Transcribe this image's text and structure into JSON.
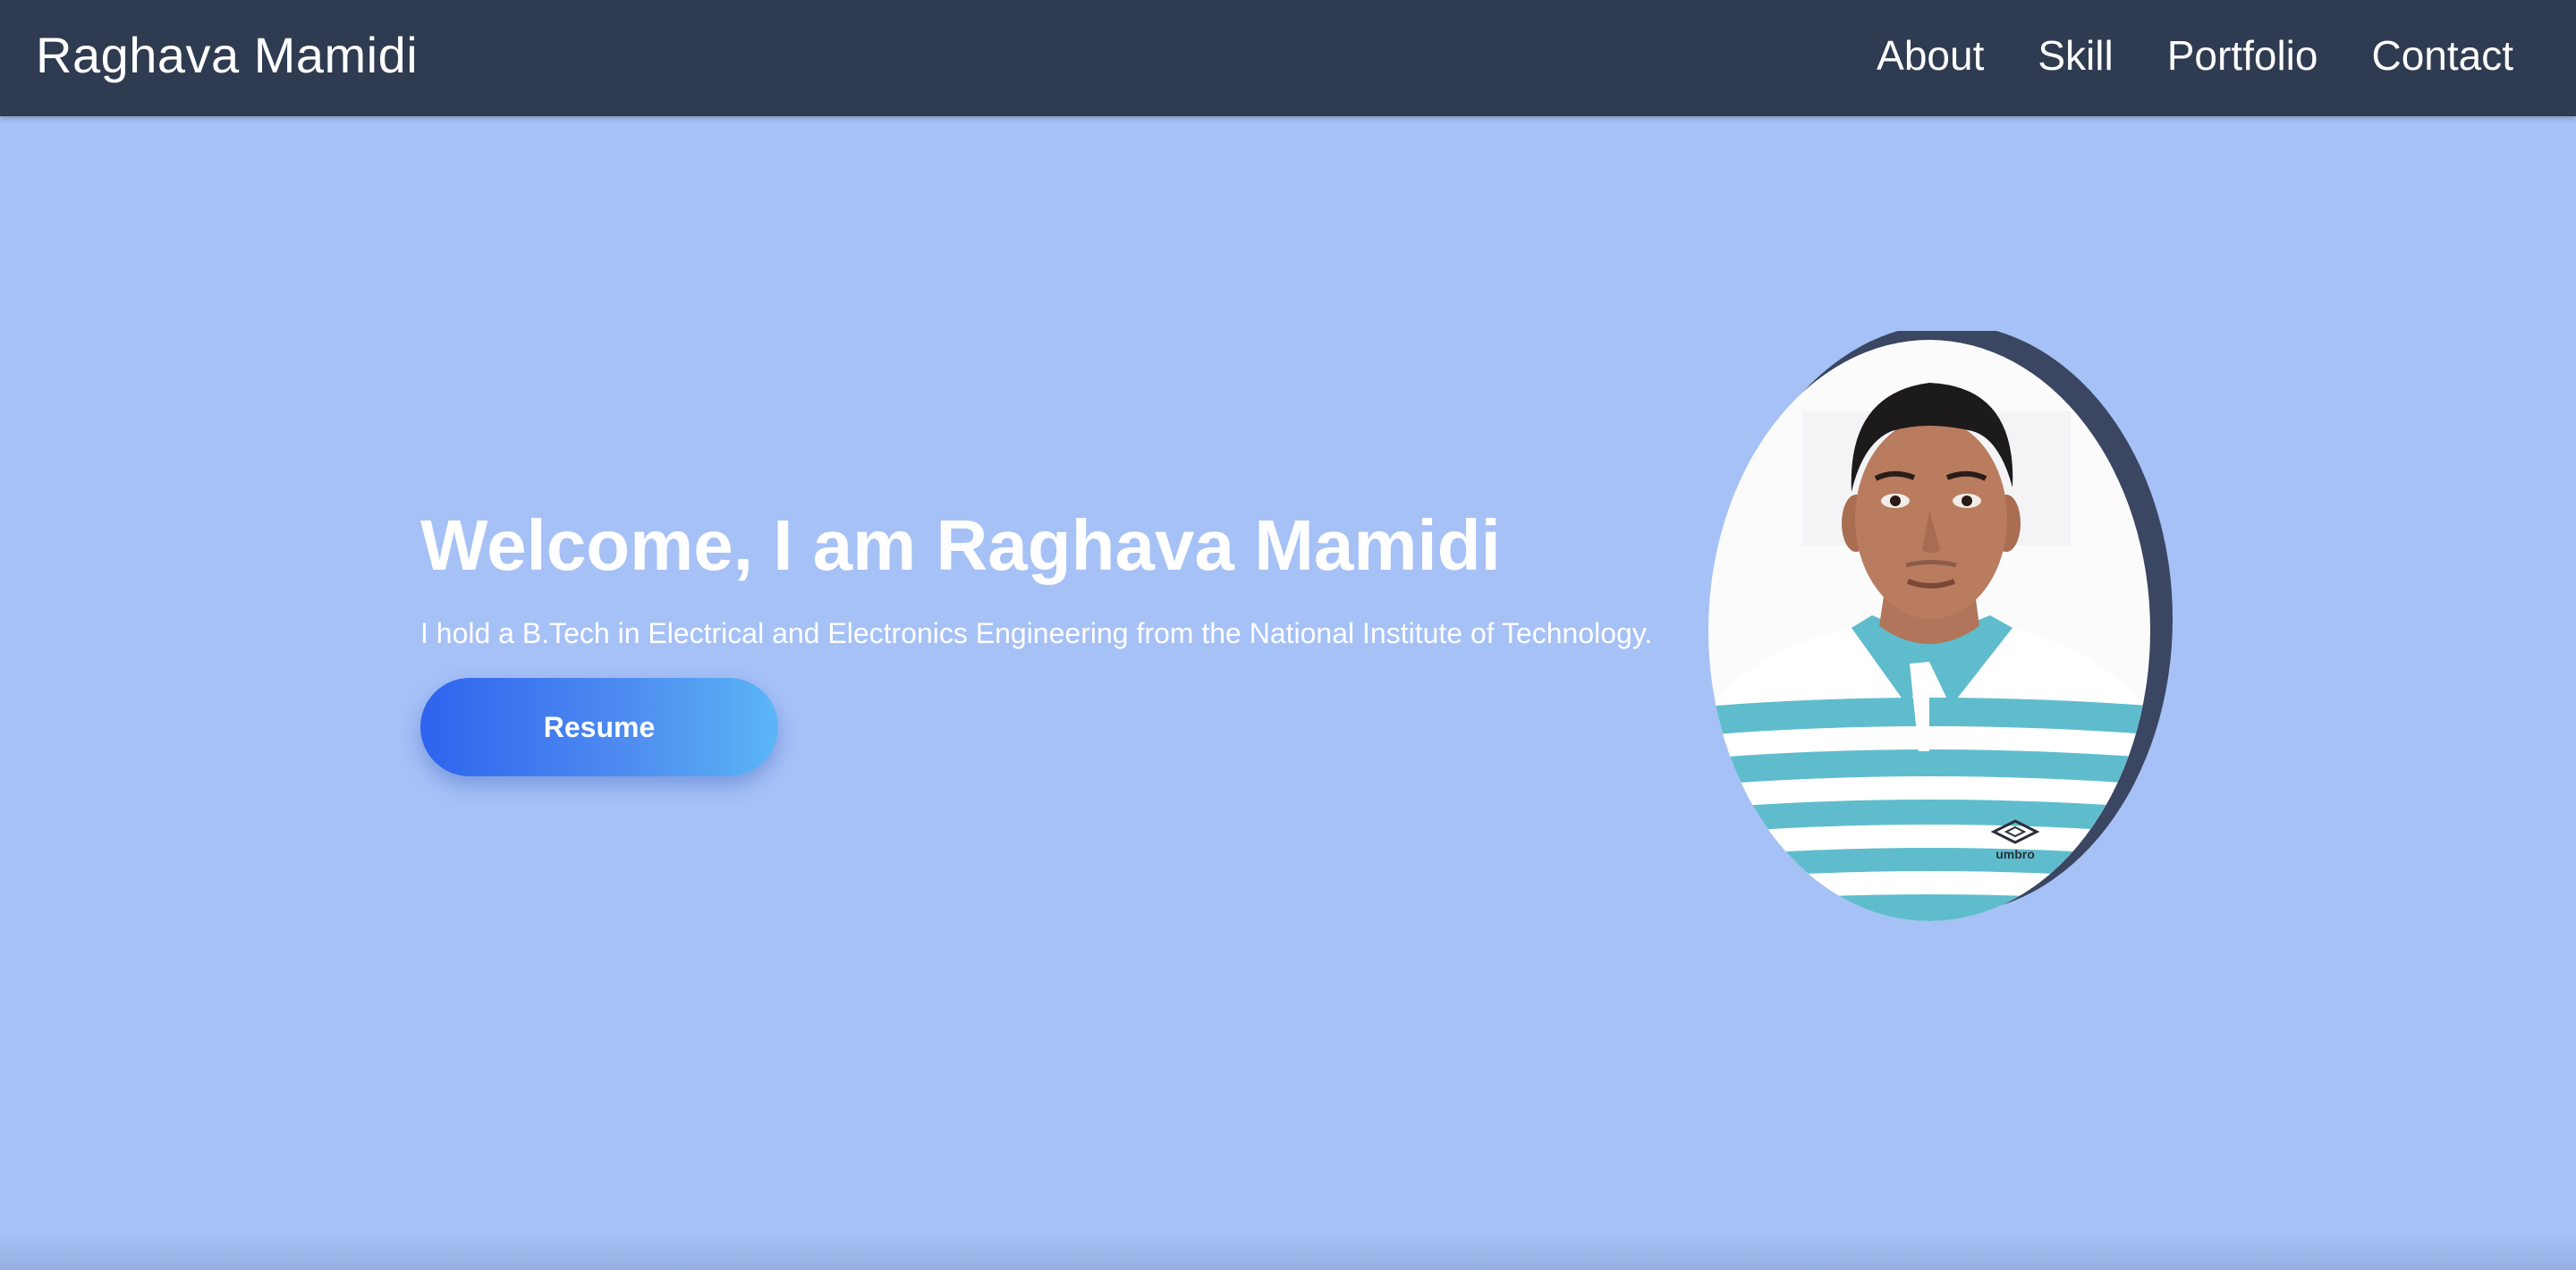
{
  "header": {
    "brand": "Raghava Mamidi",
    "nav": [
      {
        "label": "About"
      },
      {
        "label": "Skill"
      },
      {
        "label": "Portfolio"
      },
      {
        "label": "Contact"
      }
    ]
  },
  "hero": {
    "title": "Welcome, I am Raghava Mamidi",
    "subtitle": "I hold a B.Tech in Electrical and Electronics Engineering from the National Institute of Technology.",
    "resume_label": "Resume",
    "shirt_logo_text": "umbro"
  },
  "colors": {
    "navbar": "#2f3b50",
    "background": "#a6c1f6",
    "button_start": "#2e63ee",
    "button_end": "#5ab6f6",
    "photo_ring": "#3a4662",
    "shirt_stripe": "#5fbccd"
  },
  "icons": {
    "profile": "profile-photo"
  }
}
